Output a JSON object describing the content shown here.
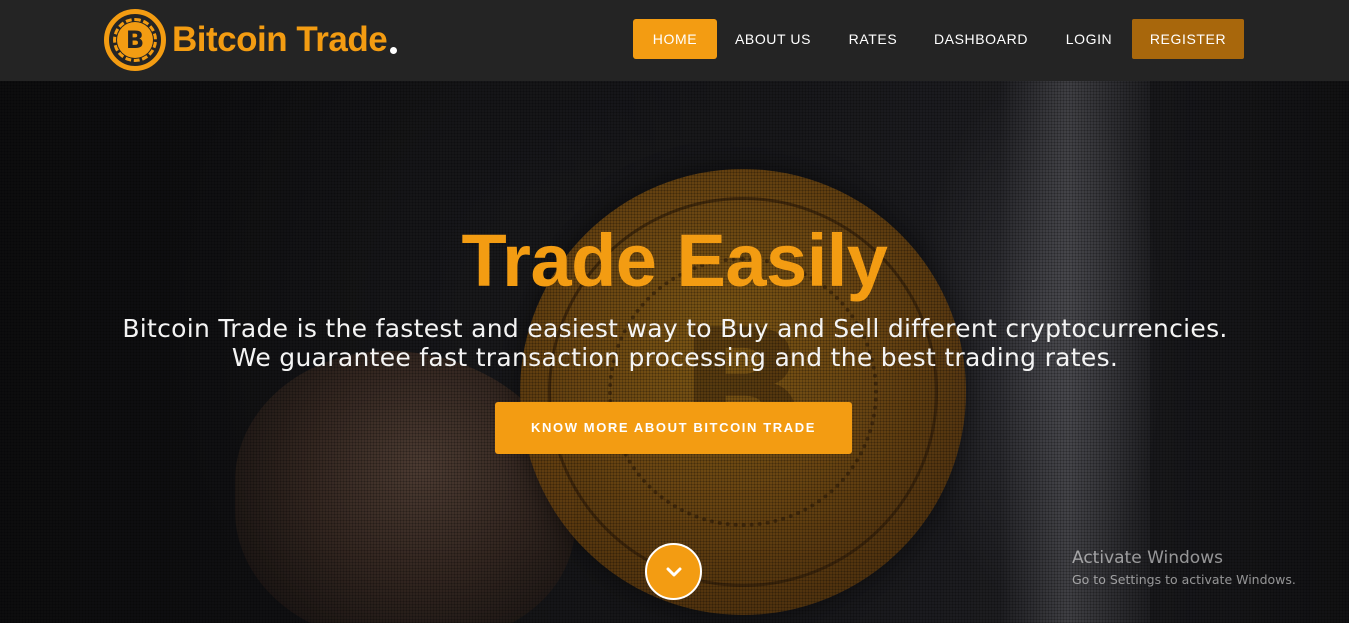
{
  "brand": {
    "name": "Bitcoin Trade",
    "coin_symbol": "B",
    "accent": "#f39c12"
  },
  "nav": {
    "items": [
      {
        "label": "HOME",
        "active": true
      },
      {
        "label": "ABOUT US"
      },
      {
        "label": "RATES"
      },
      {
        "label": "DASHBOARD"
      },
      {
        "label": "LOGIN"
      },
      {
        "label": "REGISTER",
        "highlight": "#a8670c"
      }
    ]
  },
  "hero": {
    "title": "Trade Easily",
    "subtitle": "Bitcoin Trade is the fastest and easiest way to Buy and Sell different cryptocurrencies. We guarantee fast transaction processing and the best trading rates.",
    "cta_label": "KNOW MORE ABOUT BITCOIN TRADE",
    "scroll_icon": "chevron-down-icon"
  },
  "system_overlay": {
    "title": "Activate Windows",
    "subtitle": "Go to Settings to activate Windows."
  }
}
